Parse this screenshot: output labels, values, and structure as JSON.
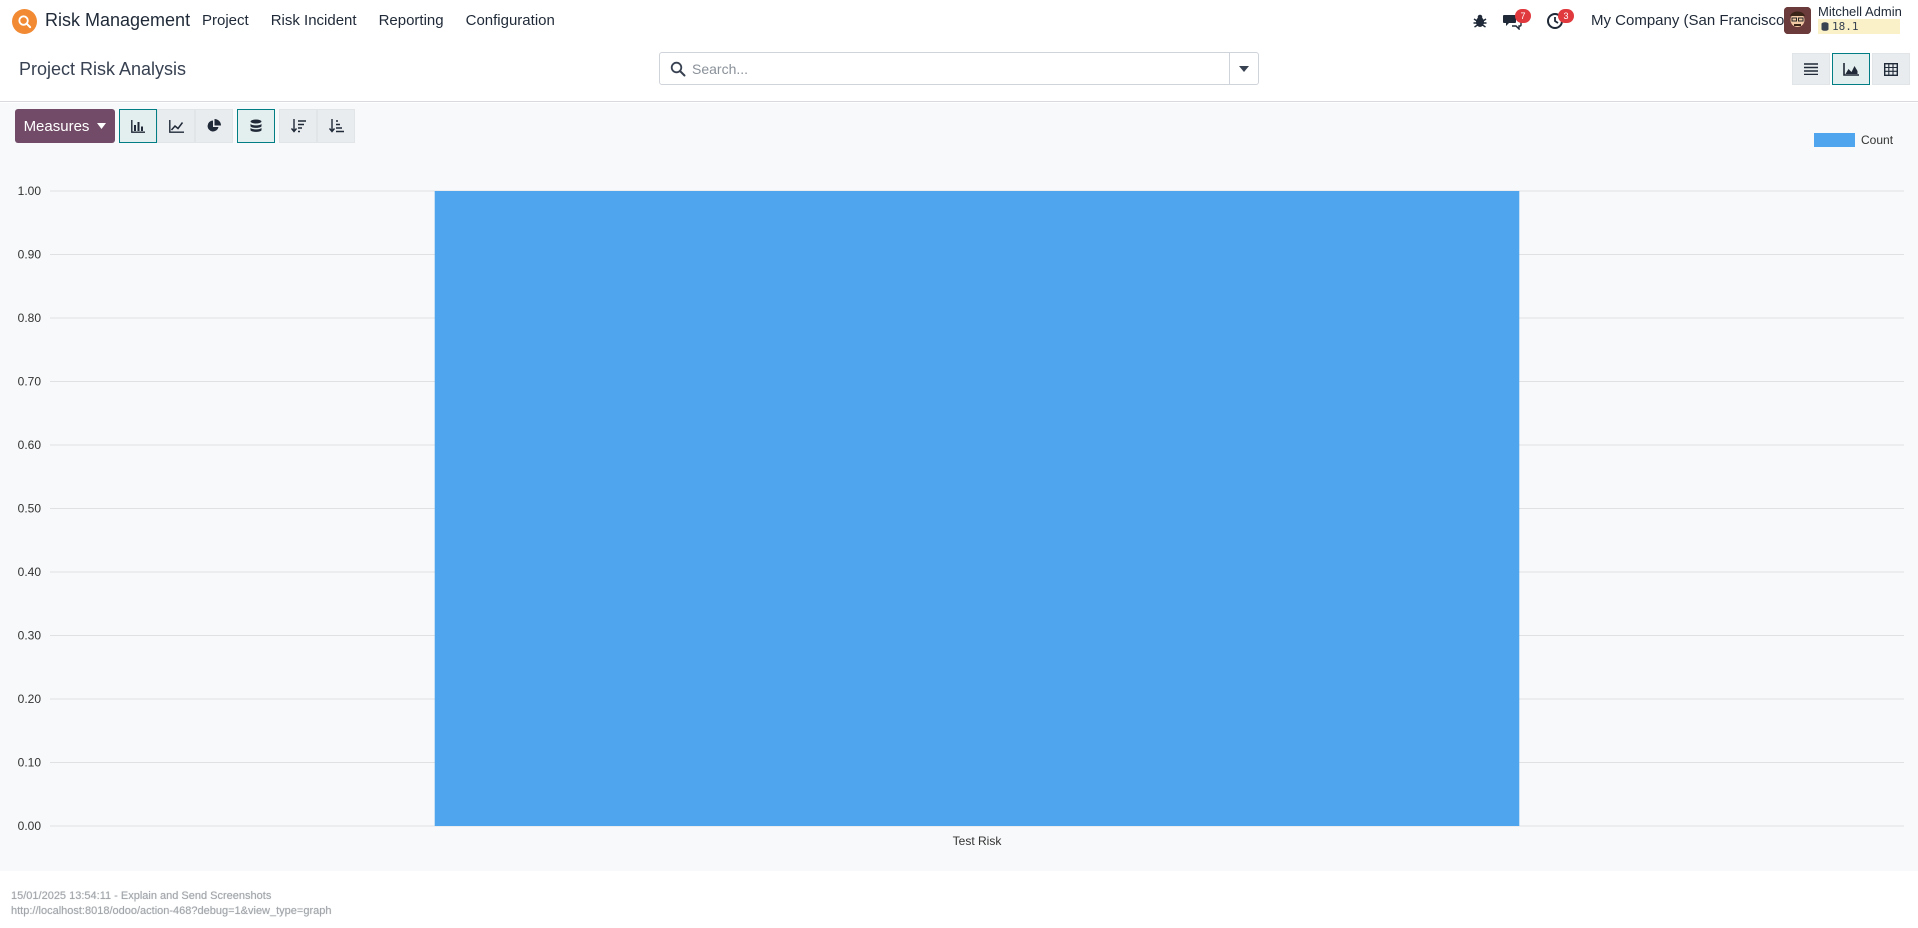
{
  "navbar": {
    "app_name": "Risk Management",
    "menu": [
      "Project",
      "Risk Incident",
      "Reporting",
      "Configuration"
    ],
    "messages_badge": "7",
    "activities_badge": "3",
    "company": "My Company (San Francisco)",
    "user_name": "Mitchell Admin",
    "db_version": "18.1"
  },
  "control": {
    "title": "Project Risk Analysis",
    "search_placeholder": "Search..."
  },
  "toolbar": {
    "measures_label": "Measures"
  },
  "colors": {
    "brand": "#714b67",
    "accent": "#017e84",
    "bar": "#50a5ef",
    "badge": "#e0393e"
  },
  "chart_data": {
    "type": "bar",
    "categories": [
      "Test Risk"
    ],
    "series": [
      {
        "name": "Count",
        "values": [
          1
        ]
      }
    ],
    "ylim": [
      0,
      1
    ],
    "yticks": [
      "0.00",
      "0.10",
      "0.20",
      "0.30",
      "0.40",
      "0.50",
      "0.60",
      "0.70",
      "0.80",
      "0.90",
      "1.00"
    ],
    "grid": true,
    "legend": "top-right"
  },
  "footer": {
    "line1": "15/01/2025 13:54:11 - Explain and Send Screenshots",
    "line2": "http://localhost:8018/odoo/action-468?debug=1&view_type=graph"
  }
}
